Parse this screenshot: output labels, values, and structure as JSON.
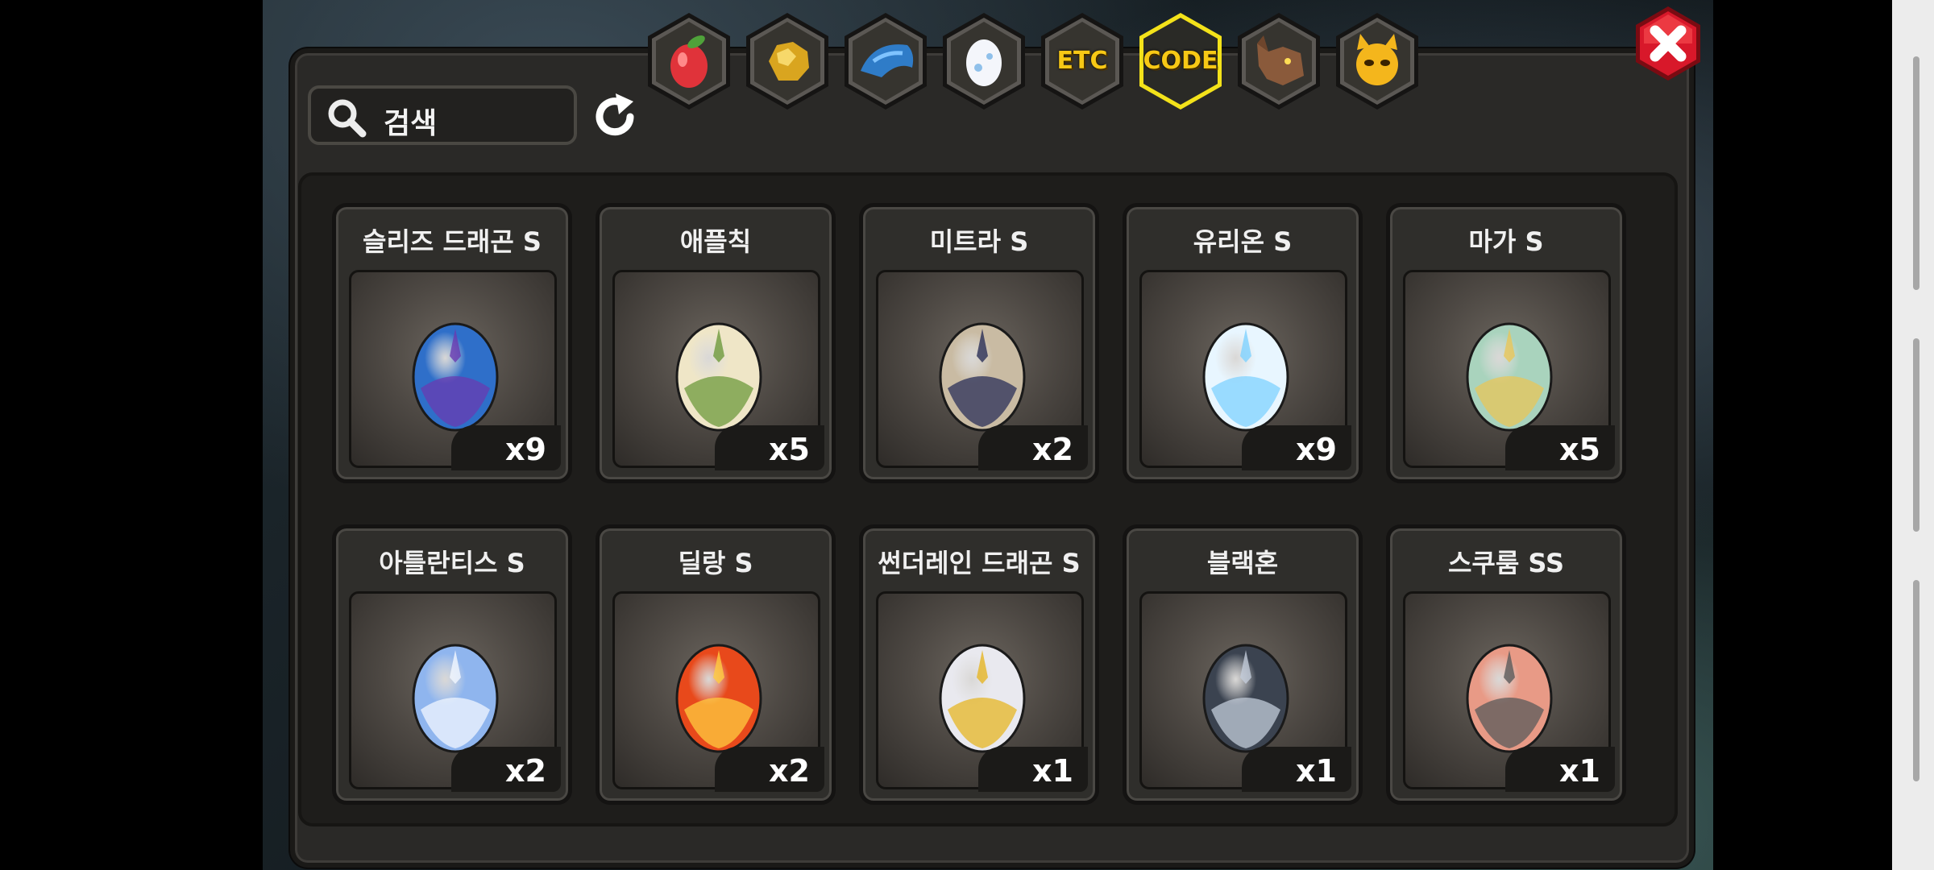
{
  "search": {
    "placeholder": "검색"
  },
  "tabs": [
    {
      "name": "fruit-tab",
      "icon": "fruit-icon",
      "label": ""
    },
    {
      "name": "gold-tab",
      "icon": "gold-nugget-icon",
      "label": ""
    },
    {
      "name": "dragon-tab",
      "icon": "dragon-head-icon",
      "label": ""
    },
    {
      "name": "egg-tab",
      "icon": "egg-icon",
      "label": ""
    },
    {
      "name": "etc-tab",
      "icon": "",
      "label": "ETC"
    },
    {
      "name": "code-tab",
      "icon": "",
      "label": "CODE",
      "selected": true
    },
    {
      "name": "wolf-tab",
      "icon": "wolf-head-icon",
      "label": ""
    },
    {
      "name": "demon-tab",
      "icon": "demon-face-icon",
      "label": ""
    }
  ],
  "items": [
    {
      "name": "슬리즈 드래곤 S",
      "count": "x9",
      "egg_color": "#2f6fc9",
      "egg_accent": "#6a3bb0"
    },
    {
      "name": "애플칙",
      "count": "x5",
      "egg_color": "#efe6c7",
      "egg_accent": "#6e9a3c"
    },
    {
      "name": "미트라 S",
      "count": "x2",
      "egg_color": "#c9bba3",
      "egg_accent": "#2a2f58"
    },
    {
      "name": "유리온 S",
      "count": "x9",
      "egg_color": "#e8f6ff",
      "egg_accent": "#7fd2ff"
    },
    {
      "name": "마가 S",
      "count": "x5",
      "egg_color": "#a9d3bd",
      "egg_accent": "#e8c659"
    },
    {
      "name": "아틀란티스 S",
      "count": "x2",
      "egg_color": "#8fb5ee",
      "egg_accent": "#f2f7ff"
    },
    {
      "name": "딜랑 S",
      "count": "x2",
      "egg_color": "#e8491b",
      "egg_accent": "#ffcc40"
    },
    {
      "name": "썬더레인 드래곤 S",
      "count": "x1",
      "egg_color": "#e9e9ef",
      "egg_accent": "#e6b524"
    },
    {
      "name": "블랙혼",
      "count": "x1",
      "egg_color": "#3b4350",
      "egg_accent": "#c3ccd9"
    },
    {
      "name": "스쿠룸 SS",
      "count": "x1",
      "egg_color": "#e89a86",
      "egg_accent": "#5a5a5a"
    }
  ],
  "icons": {
    "search": "magnifier-icon",
    "refresh": "refresh-icon",
    "close": "close-icon"
  },
  "colors": {
    "tab_selected_ring": "#f3e21a",
    "close_red": "#d8182a",
    "code_text": "#f7c815"
  }
}
